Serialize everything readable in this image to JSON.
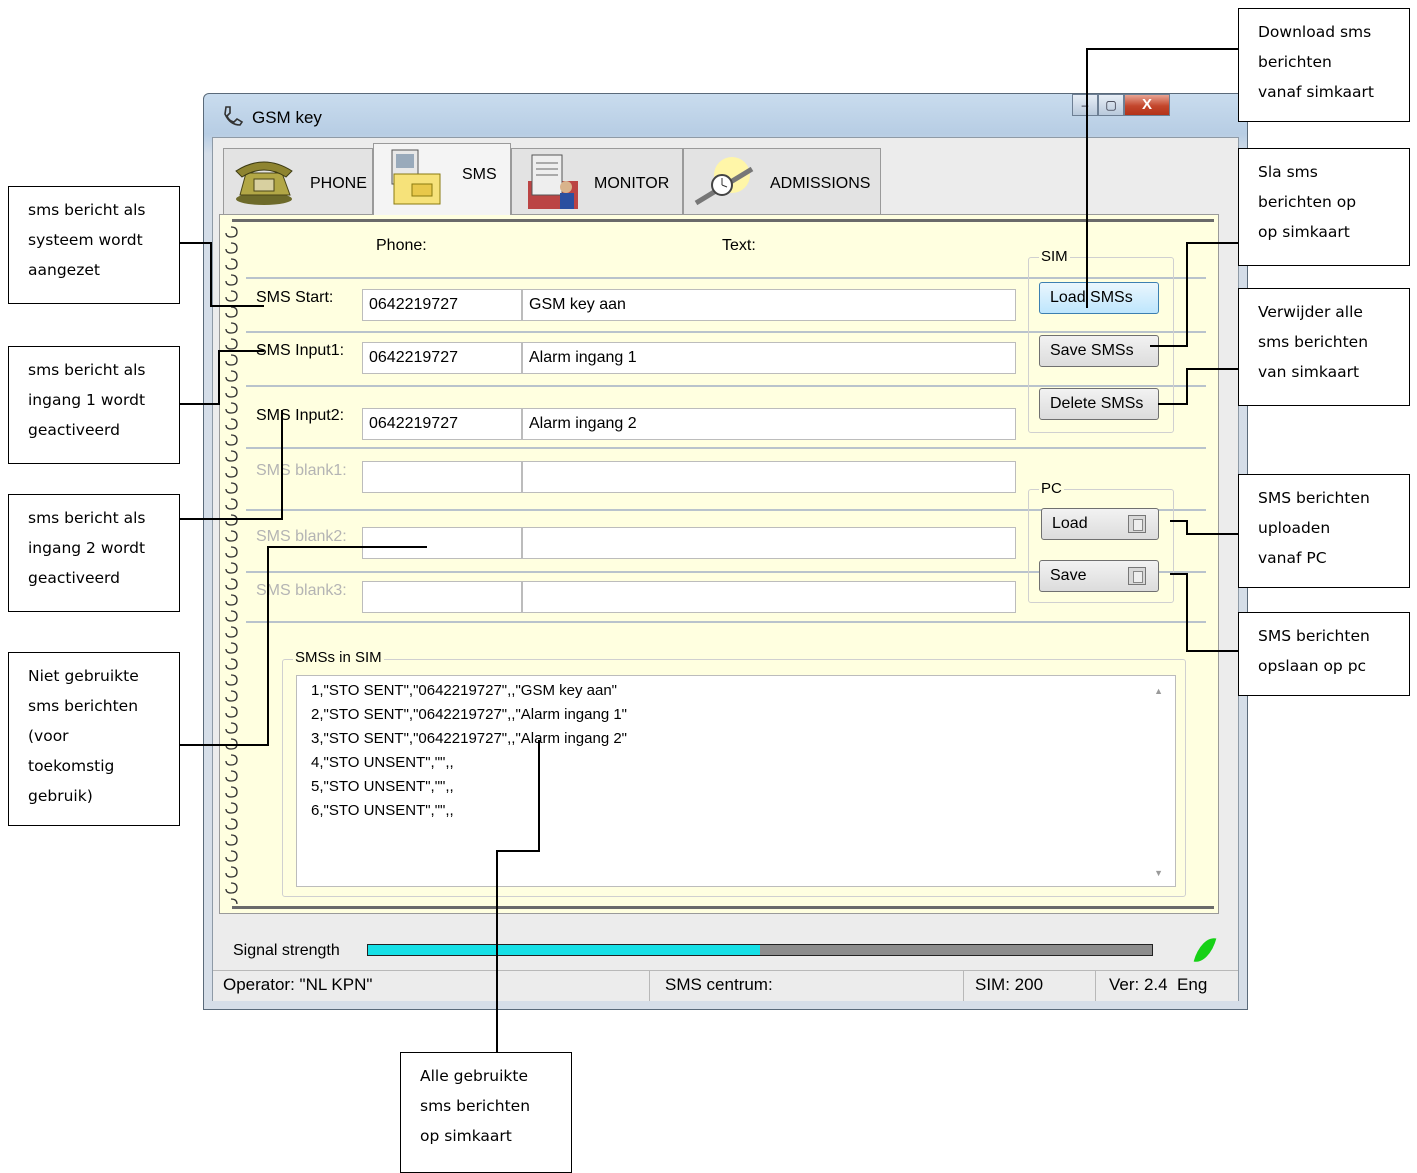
{
  "window": {
    "title": "GSM key",
    "minimize_glyph": "–",
    "maximize_glyph": "▢",
    "close_glyph": "X"
  },
  "tabs": [
    {
      "label": "PHONE",
      "icon": "phone-icon"
    },
    {
      "label": "SMS",
      "icon": "sms-icon"
    },
    {
      "label": "MONITOR",
      "icon": "monitor-icon"
    },
    {
      "label": "ADMISSIONS",
      "icon": "admissions-icon"
    }
  ],
  "headers": {
    "phone": "Phone:",
    "text": "Text:"
  },
  "rows": [
    {
      "label": "SMS Start:",
      "phone": "0642219727",
      "text": "GSM key aan",
      "enabled": true
    },
    {
      "label": "SMS Input1:",
      "phone": "0642219727",
      "text": "Alarm ingang 1",
      "enabled": true
    },
    {
      "label": "SMS Input2:",
      "phone": "0642219727",
      "text": "Alarm ingang 2",
      "enabled": true
    },
    {
      "label": "SMS blank1:",
      "phone": "",
      "text": "",
      "enabled": false
    },
    {
      "label": "SMS blank2:",
      "phone": "",
      "text": "",
      "enabled": false
    },
    {
      "label": "SMS blank3:",
      "phone": "",
      "text": "",
      "enabled": false
    }
  ],
  "sim_group": {
    "label": "SIM",
    "load": "Load SMSs",
    "save": "Save SMSs",
    "delete": "Delete SMSs"
  },
  "pc_group": {
    "label": "PC",
    "load": "Load",
    "save": "Save"
  },
  "sim_list": {
    "label": "SMSs in SIM",
    "lines": [
      "1,\"STO SENT\",\"0642219727\",,\"GSM key aan\"",
      "2,\"STO SENT\",\"0642219727\",,\"Alarm ingang 1\"",
      "3,\"STO SENT\",\"0642219727\",,\"Alarm ingang 2\"",
      "4,\"STO UNSENT\",\"\",,",
      "5,\"STO UNSENT\",\"\",,",
      "6,\"STO UNSENT\",\"\",,"
    ]
  },
  "signal": {
    "label": "Signal strength",
    "level": 0.5,
    "fill_color": "#16e0e6",
    "indicator_color": "#17d117"
  },
  "statusbar": {
    "operator": "Operator: \"NL KPN\"",
    "sms_centre": "SMS centrum:",
    "sim": "SIM: 200",
    "version": "Ver: 2.4  Eng"
  },
  "annotations": {
    "download": "Download sms\nberichten\nvanaf simkaart",
    "save_sim": "Sla sms\nberichten op\nop simkaart",
    "delete_sim": "Verwijder alle\nsms berichten\nvan simkaart",
    "upload_pc": "SMS berichten\nuploaden\nvanaf PC",
    "save_pc": "SMS berichten\nopslaan op pc",
    "start": "sms bericht als\nsysteem wordt\naangezet",
    "input1": "sms bericht als\ningang 1 wordt\ngeactiveerd",
    "input2": "sms bericht als\ningang 2 wordt\ngeactiveerd",
    "unused": "Niet gebruikte\nsms berichten\n(voor\ntoekomstig\ngebruik)",
    "all_used": "Alle gebruikte\nsms berichten\nop simkaart"
  }
}
